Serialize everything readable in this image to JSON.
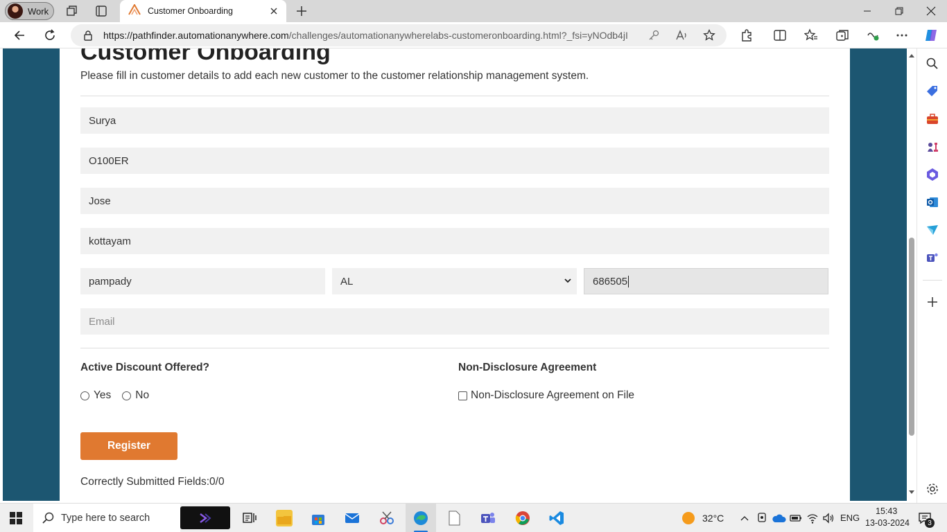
{
  "browser": {
    "profile_label": "Work",
    "tab_title": "Customer Onboarding",
    "url_host": "https://pathfinder.automationanywhere.com",
    "url_path": "/challenges/automationanywherelabs-customeronboarding.html?_fsi=yNOdb4jI"
  },
  "page": {
    "heading": "Customer Onboarding",
    "description": "Please fill in customer details to add each new customer to the customer relationship management system.",
    "fields": {
      "customer_name": "Surya",
      "customer_id": "O100ER",
      "primary_contact": "Jose",
      "street_address": "kottayam",
      "city": "pampady",
      "state": "AL",
      "zip": "686505",
      "email_placeholder": "Email"
    },
    "discount_label": "Active Discount Offered?",
    "discount_yes": "Yes",
    "discount_no": "No",
    "nda_label": "Non-Disclosure Agreement",
    "nda_checkbox_label": "Non-Disclosure Agreement on File",
    "register_label": "Register",
    "status_text": "Correctly Submitted Fields:0/0"
  },
  "taskbar": {
    "search_placeholder": "Type here to search",
    "temperature": "32°C",
    "language": "ENG",
    "time": "15:43",
    "date": "13-03-2024",
    "notification_count": "3"
  },
  "colors": {
    "page_background": "#1c5671",
    "register_button": "#e07930",
    "field_background": "#f1f1f1"
  }
}
